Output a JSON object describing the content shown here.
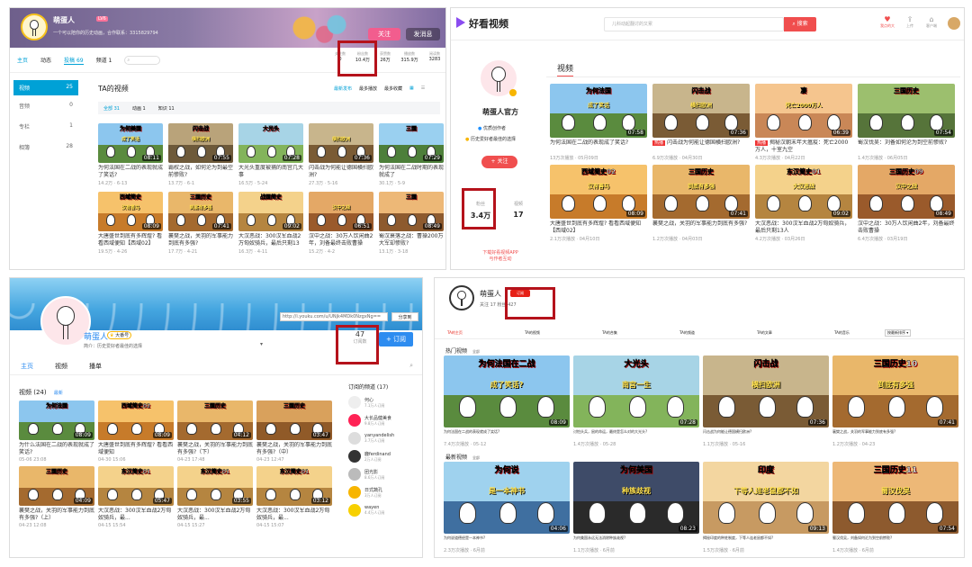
{
  "p1": {
    "name": "萌蛋人",
    "subtitle": "一个可以陪你的历史动画，合作联系：3315829794",
    "follow": "关注",
    "message": "发消息",
    "nav": [
      "主页",
      "动态",
      "投稿 69",
      "频道 1"
    ],
    "stats": [
      {
        "label": "关注数",
        "value": "0"
      },
      {
        "label": "粉丝数",
        "value": "10.4万"
      },
      {
        "label": "获赞数",
        "value": "26万"
      },
      {
        "label": "播放数",
        "value": "315.9万"
      },
      {
        "label": "阅读数",
        "value": "3283"
      }
    ],
    "side": [
      {
        "label": "视频",
        "count": "25"
      },
      {
        "label": "音频",
        "count": "0"
      },
      {
        "label": "专栏",
        "count": "1"
      },
      {
        "label": "相簿",
        "count": "28"
      }
    ],
    "section": "TA的视频",
    "sorts": [
      "最新发布",
      "最多播放",
      "最多收藏"
    ],
    "filters": [
      "全部 31",
      "动画 1",
      "知识 11"
    ],
    "videos": [
      {
        "cap": "为何美国",
        "cap2": "成了笑话",
        "dur": "08:11",
        "title": "为何法国在二战的表现就成了笑话?",
        "meta": "14.2万 · 6-13",
        "sky": "#8cc6ee",
        "ground": "#5a8b3e"
      },
      {
        "cap": "闪击战",
        "cap2": "横扫欧洲",
        "dur": "07:55",
        "title": "霸权之战，如何沦为到最空前惨败?",
        "meta": "13.7万 · 6-1",
        "sky": "#b9a37a",
        "ground": "#6e5a3a"
      },
      {
        "cap": "大光头",
        "cap2": "",
        "dur": "07:28",
        "title": "大光头重度被捕的南宫几大事",
        "meta": "16.5万 · 5-24",
        "sky": "#a7d4e6",
        "ground": "#83b45b"
      },
      {
        "cap": "",
        "cap2": "横扫欧洲",
        "dur": "07:36",
        "title": "闪击战为何能让德国横扫欧洲?",
        "meta": "27.3万 · 5-16",
        "sky": "#c8b58c",
        "ground": "#7a5b35"
      },
      {
        "cap": "三国",
        "cap2": "",
        "dur": "07:29",
        "title": "为何法国在二战时期的表现就成了",
        "meta": "30.1万 · 5-9",
        "sky": "#9ad0f0",
        "ground": "#4d7f3a"
      },
      {
        "cap": "西域简史",
        "cap2": "汉有善马",
        "dur": "08:09",
        "title": "大唐盛世到底有多辉煌? 看看西域便知【西域02】",
        "meta": "19.5万 · 4-26",
        "sky": "#f6c26b",
        "ground": "#c77b2a"
      },
      {
        "cap": "三国历史",
        "cap2": "到底有多强",
        "dur": "07:41",
        "title": "襄樊之战，关羽的军事能力到底有多强?",
        "meta": "17.7万 · 4-21",
        "sky": "#e9b76a",
        "ground": "#a46a2f"
      },
      {
        "cap": "战国简史",
        "cap2": "",
        "dur": "09:02",
        "title": "大汉恶战：300汉军血战2万匈奴骑兵，最后只剩13人",
        "meta": "16.3万 · 4-11",
        "sky": "#f4d28b",
        "ground": "#b58540"
      },
      {
        "cap": "",
        "cap2": "汉中之战",
        "dur": "06:51",
        "title": "汉中之战：30万人饮闲曲2年，刘备最终击败曹操",
        "meta": "15.2万 · 4-2",
        "sky": "#e4a866",
        "ground": "#9a5a2b"
      },
      {
        "cap": "三国",
        "cap2": "",
        "dur": "08:49",
        "title": "蜀汉衰落之战：曹操200万大军却惨败?",
        "meta": "13.1万 · 3-18",
        "sky": "#edb877",
        "ground": "#8d5a2e"
      }
    ]
  },
  "p2": {
    "logo": "好看视频",
    "search_placeholder": "儿科动起翻讨的又累",
    "search_btn": "搜索",
    "top_icons": [
      {
        "label": "我点的大",
        "icon": "heart-icon"
      },
      {
        "label": "上传",
        "icon": "upload-icon"
      },
      {
        "label": "客户端",
        "icon": "home-icon"
      }
    ],
    "name": "萌蛋人官方",
    "badges": [
      "优质创作者",
      "历史爱好者最佳的选择"
    ],
    "follow": "关注",
    "stats": [
      {
        "label": "粉丝",
        "value": "3.4万"
      },
      {
        "label": "视频",
        "value": "17"
      }
    ],
    "promo": "下载好看视频APP\n与作者互动",
    "tab": "视频",
    "videos": [
      {
        "cap": "为何法国",
        "cap2": "成了笑话",
        "dur": "07:58",
        "tag": "",
        "title": "为何法国在二战的表现成了笑话?",
        "meta": "13万次播放  · 05月09日",
        "sky": "#8cc6ee",
        "ground": "#5a8b3e"
      },
      {
        "cap": "闪击战",
        "cap2": "横扫欧洲",
        "dur": "07:36",
        "tag": "热播",
        "title": "闪击战为何能让德国横扫欧洲?",
        "meta": "6.9万次播放 · 04月30日",
        "sky": "#c8b58c",
        "ground": "#7a5b35"
      },
      {
        "cap": "凄",
        "cap2": "死亡2000万人",
        "dur": "06:39",
        "tag": "热播",
        "title": "揭秘汉朝末年大瘟疫：死亡2000万人，十室九空",
        "meta": "4.3万次播放 · 04月22日",
        "sky": "#f5c58e",
        "ground": "#c98757"
      },
      {
        "cap": "三国历史",
        "cap2": "",
        "dur": "07:54",
        "tag": "",
        "title": "蜀汉伐吴：刘备如何沦为到空前惨败?",
        "meta": "1.4万次播放 · 06月05日",
        "sky": "#9cbf6e",
        "ground": "#56743a"
      },
      {
        "cap": "西域简史02",
        "cap2": "汉有善马",
        "dur": "08:09",
        "tag": "",
        "title": "大唐盛世到底有多辉煌? 看看西域便知【西域02】",
        "meta": "2.1万次播放 · 04月10日",
        "sky": "#f6c26b",
        "ground": "#c77b2a"
      },
      {
        "cap": "三国历史",
        "cap2": "到底有多强",
        "dur": "07:41",
        "tag": "",
        "title": "襄樊之战，关羽的军事能力到底有多强?",
        "meta": "1.2万次播放 · 04月03日",
        "sky": "#e9b76a",
        "ground": "#a46a2f"
      },
      {
        "cap": "东汉简史01",
        "cap2": "大汉恶战",
        "dur": "09:02",
        "tag": "",
        "title": "大汉恶战：300汉军血战2万匈奴骑兵，最后只剩13人",
        "meta": "4.2万次播放 · 03月26日",
        "sky": "#f4d28b",
        "ground": "#b58540"
      },
      {
        "cap": "三国历史09",
        "cap2": "汉中之战",
        "dur": "08:49",
        "tag": "",
        "title": "汉中之战：30万人饮闲曲2年，刘备最终击败曹操",
        "meta": "6.4万次播放 · 03月19日",
        "sky": "#e4a866",
        "ground": "#9a5a2b"
      }
    ]
  },
  "p3": {
    "name": "萌蛋人",
    "badge": "大番号",
    "desc": "简介：历史爱好者最佳的选择",
    "url": "http://i.youku.com/u/UNjk4MDk0NzgxNg==",
    "share": "分享到",
    "sub_count": "47",
    "sub_label": "订阅数",
    "subscribe": "+ 订阅",
    "tabs": [
      "主页",
      "视频",
      "播单"
    ],
    "section": "视频 (24)",
    "sort": "最新",
    "sub_title": "订阅的频道 (17)",
    "channels": [
      {
        "name": "何心",
        "meta": "7.1万人订阅"
      },
      {
        "name": "大长品健美食",
        "meta": "9.8万人订阅"
      },
      {
        "name": "yanyandelish",
        "meta": "3.7万人订阅"
      },
      {
        "name": "鹿ferdinand",
        "meta": "2万人订阅"
      },
      {
        "name": "团光影",
        "meta": "8.6万人订阅"
      },
      {
        "name": "日式蔬孔",
        "meta": "3万人订阅"
      },
      {
        "name": "wayen",
        "meta": "4.4万人订阅"
      }
    ],
    "videos": [
      {
        "cap": "为何法国",
        "cap2": "",
        "dur": "08:09",
        "title": "为什么法国在二战的表现就成了笑话?",
        "meta": "05-06 23:08",
        "sky": "#8cc6ee",
        "ground": "#5a8b3e"
      },
      {
        "cap": "西域简史02",
        "cap2": "",
        "dur": "08:09",
        "title": "大唐盛世到底有多辉煌? 看看西域便知",
        "meta": "04-30 15:06",
        "sky": "#f6c26b",
        "ground": "#c77b2a"
      },
      {
        "cap": "三国历史",
        "cap2": "",
        "dur": "04:12",
        "title": "襄樊之战，关羽的军事能力到底有多强?（下）",
        "meta": "04-23 17:48",
        "sky": "#e9b76a",
        "ground": "#a46a2f"
      },
      {
        "cap": "三国历史",
        "cap2": "",
        "dur": "03:47",
        "title": "襄樊之战，关羽的军事能力到底有多强?（中）",
        "meta": "04-23 12:47",
        "sky": "#d9a15c",
        "ground": "#905a28"
      },
      {
        "cap": "三国历史",
        "cap2": "",
        "dur": "04:09",
        "title": "襄樊之战，关羽的军事能力到底有多强?（上）",
        "meta": "04-23 12:08",
        "sky": "#e9b76a",
        "ground": "#a46a2f"
      },
      {
        "cap": "东汉简史01",
        "cap2": "",
        "dur": "05:47",
        "title": "大汉恶战：300汉军血战2万匈奴骑兵，最...",
        "meta": "04-15 15:54",
        "sky": "#f4d28b",
        "ground": "#b58540"
      },
      {
        "cap": "东汉简史01",
        "cap2": "",
        "dur": "03:55",
        "title": "大汉恶战：300汉军血战2万匈奴骑兵，最...",
        "meta": "04-15 15:27",
        "sky": "#f4d28b",
        "ground": "#b58540"
      },
      {
        "cap": "东汉简史01",
        "cap2": "",
        "dur": "03:12",
        "title": "大汉恶战：300汉军血战2万匈奴骑兵，最...",
        "meta": "04-15 15:07",
        "sky": "#f4d28b",
        "ground": "#b58540"
      }
    ]
  },
  "p4": {
    "name": "萌蛋人",
    "follow": "订阅",
    "stats": "关注 17  粉丝 427",
    "tabs": [
      "TA的主页",
      "TA的视频",
      "TA的合集",
      "TA的频道",
      "TA的文章",
      "TA的音乐"
    ],
    "select": "按最新排序",
    "hot": "热门视频",
    "hot_all": "全部",
    "latest": "最新视频",
    "latest_all": "全部",
    "hot_videos": [
      {
        "cap": "为何法国在二战",
        "cap2": "成了笑话?",
        "dur": "08:09",
        "title": "为何法国在二战的表现就成了笑话?",
        "meta": "7.4万次播放 · 05-12",
        "sky": "#8cc6ee",
        "ground": "#5a8b3e"
      },
      {
        "cap": "大光头",
        "cap2": "南宫一生",
        "dur": "07:28",
        "title": "讨怕头兵，鼠的命运，最终是怎么对的大光头?",
        "meta": "1.4万次播放 · 05-28",
        "sky": "#a7d4e6",
        "ground": "#83b45b"
      },
      {
        "cap": "闪击战",
        "cap2": "横扫欧洲",
        "dur": "07:36",
        "title": "闪击战为何能让德国横扫欧洲?",
        "meta": "1.1万次播放 · 05-16",
        "sky": "#c8b58c",
        "ground": "#7a5b35"
      },
      {
        "cap": "三国历史10",
        "cap2": "到底有多强",
        "dur": "07:41",
        "title": "襄樊之战，关羽的军事能力到底有多强?",
        "meta": "1.2万次播放 · 04-23",
        "sky": "#e9b76a",
        "ground": "#a46a2f"
      }
    ],
    "latest_videos": [
      {
        "cap": "为何说",
        "cap2": "是一本神书",
        "dur": "04:06",
        "title": "为何说道德经是一本神书?",
        "meta": "2.3万次播放 · 6月前",
        "sky": "#9fd2ee",
        "ground": "#3f6fa0"
      },
      {
        "cap": "为何美国",
        "cap2": "种族歧视",
        "dur": "08:23",
        "title": "为何美国永远无法消除种族歧视?",
        "meta": "1.1万次播放 · 6月前",
        "sky": "#3e4b68",
        "ground": "#2a2a2a"
      },
      {
        "cap": "印度",
        "cap2": "下等人连老鼠都不如",
        "dur": "09:13",
        "title": "揭秘印度的种姓制度，下等人连老鼠都不如?",
        "meta": "1.5万次播放 · 6月前",
        "sky": "#f3d6a0",
        "ground": "#c79a62"
      },
      {
        "cap": "三国历史11",
        "cap2": "蜀汉伐吴",
        "dur": "07:54",
        "title": "蜀汉伐吴，刘备如何沦为到空前惨败?",
        "meta": "1.4万次播放 · 6月前",
        "sky": "#edb877",
        "ground": "#8d5a2e"
      }
    ]
  },
  "colors": {
    "bilibili_blue": "#00a1d6",
    "haokan_red": "#f04e4e",
    "youku_blue": "#2d8cf0",
    "youtube_red": "#e62117",
    "highlight": "#b5121b"
  }
}
